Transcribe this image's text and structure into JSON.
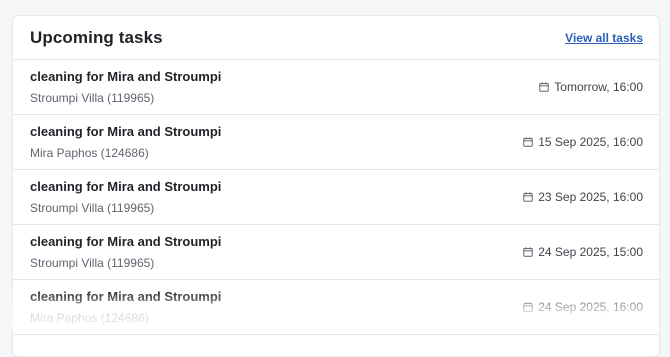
{
  "header": {
    "title": "Upcoming tasks",
    "view_all_label": "View all tasks"
  },
  "tasks": [
    {
      "title": "cleaning for Mira and Stroumpi",
      "property": "Stroumpi Villa (119965)",
      "date": "Tomorrow, 16:00"
    },
    {
      "title": "cleaning for Mira and Stroumpi",
      "property": "Mira Paphos (124686)",
      "date": "15 Sep 2025, 16:00"
    },
    {
      "title": "cleaning for Mira and Stroumpi",
      "property": "Stroumpi Villa (119965)",
      "date": "23 Sep 2025, 16:00"
    },
    {
      "title": "cleaning for Mira and Stroumpi",
      "property": "Stroumpi Villa (119965)",
      "date": "24 Sep 2025, 15:00"
    },
    {
      "title": "cleaning for Mira and Stroumpi",
      "property": "Mira Paphos (124686)",
      "date": "24 Sep 2025, 16:00"
    }
  ],
  "icons": {
    "date": "calendar-icon"
  },
  "colors": {
    "link": "#2a5fb5",
    "text": "#1f2328",
    "muted": "#5f6670",
    "border": "#e6e8ec"
  }
}
